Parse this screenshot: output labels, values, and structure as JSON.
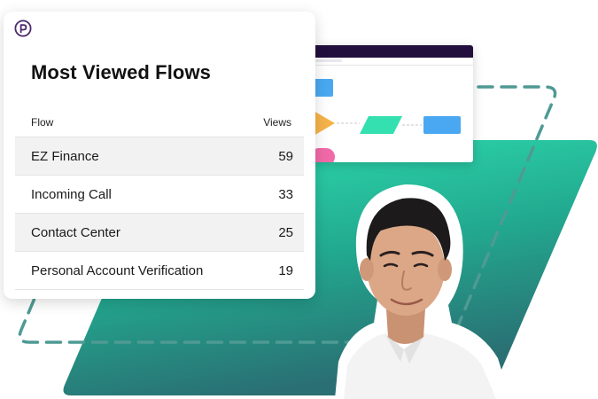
{
  "card": {
    "title": "Most Viewed Flows",
    "columns": {
      "flow": "Flow",
      "views": "Views"
    },
    "rows": [
      {
        "flow": "EZ Finance",
        "views": "59"
      },
      {
        "flow": "Incoming Call",
        "views": "33"
      },
      {
        "flow": "Contact Center",
        "views": "25"
      },
      {
        "flow": "Personal Account Verification",
        "views": "19"
      }
    ]
  },
  "colors": {
    "green_light": "#2fe3b4",
    "green_dark": "#2a8a7e",
    "dashed": "#4f9a94",
    "brand_purple": "#4a2a6e",
    "titlebar": "#220f3d",
    "node_blue": "#4aa8f2",
    "node_teal": "#34e0b0",
    "node_orange": "#f6b34a",
    "node_pink": "#f06aa8"
  },
  "icons": {
    "brand": "brand-p-logo-icon"
  }
}
